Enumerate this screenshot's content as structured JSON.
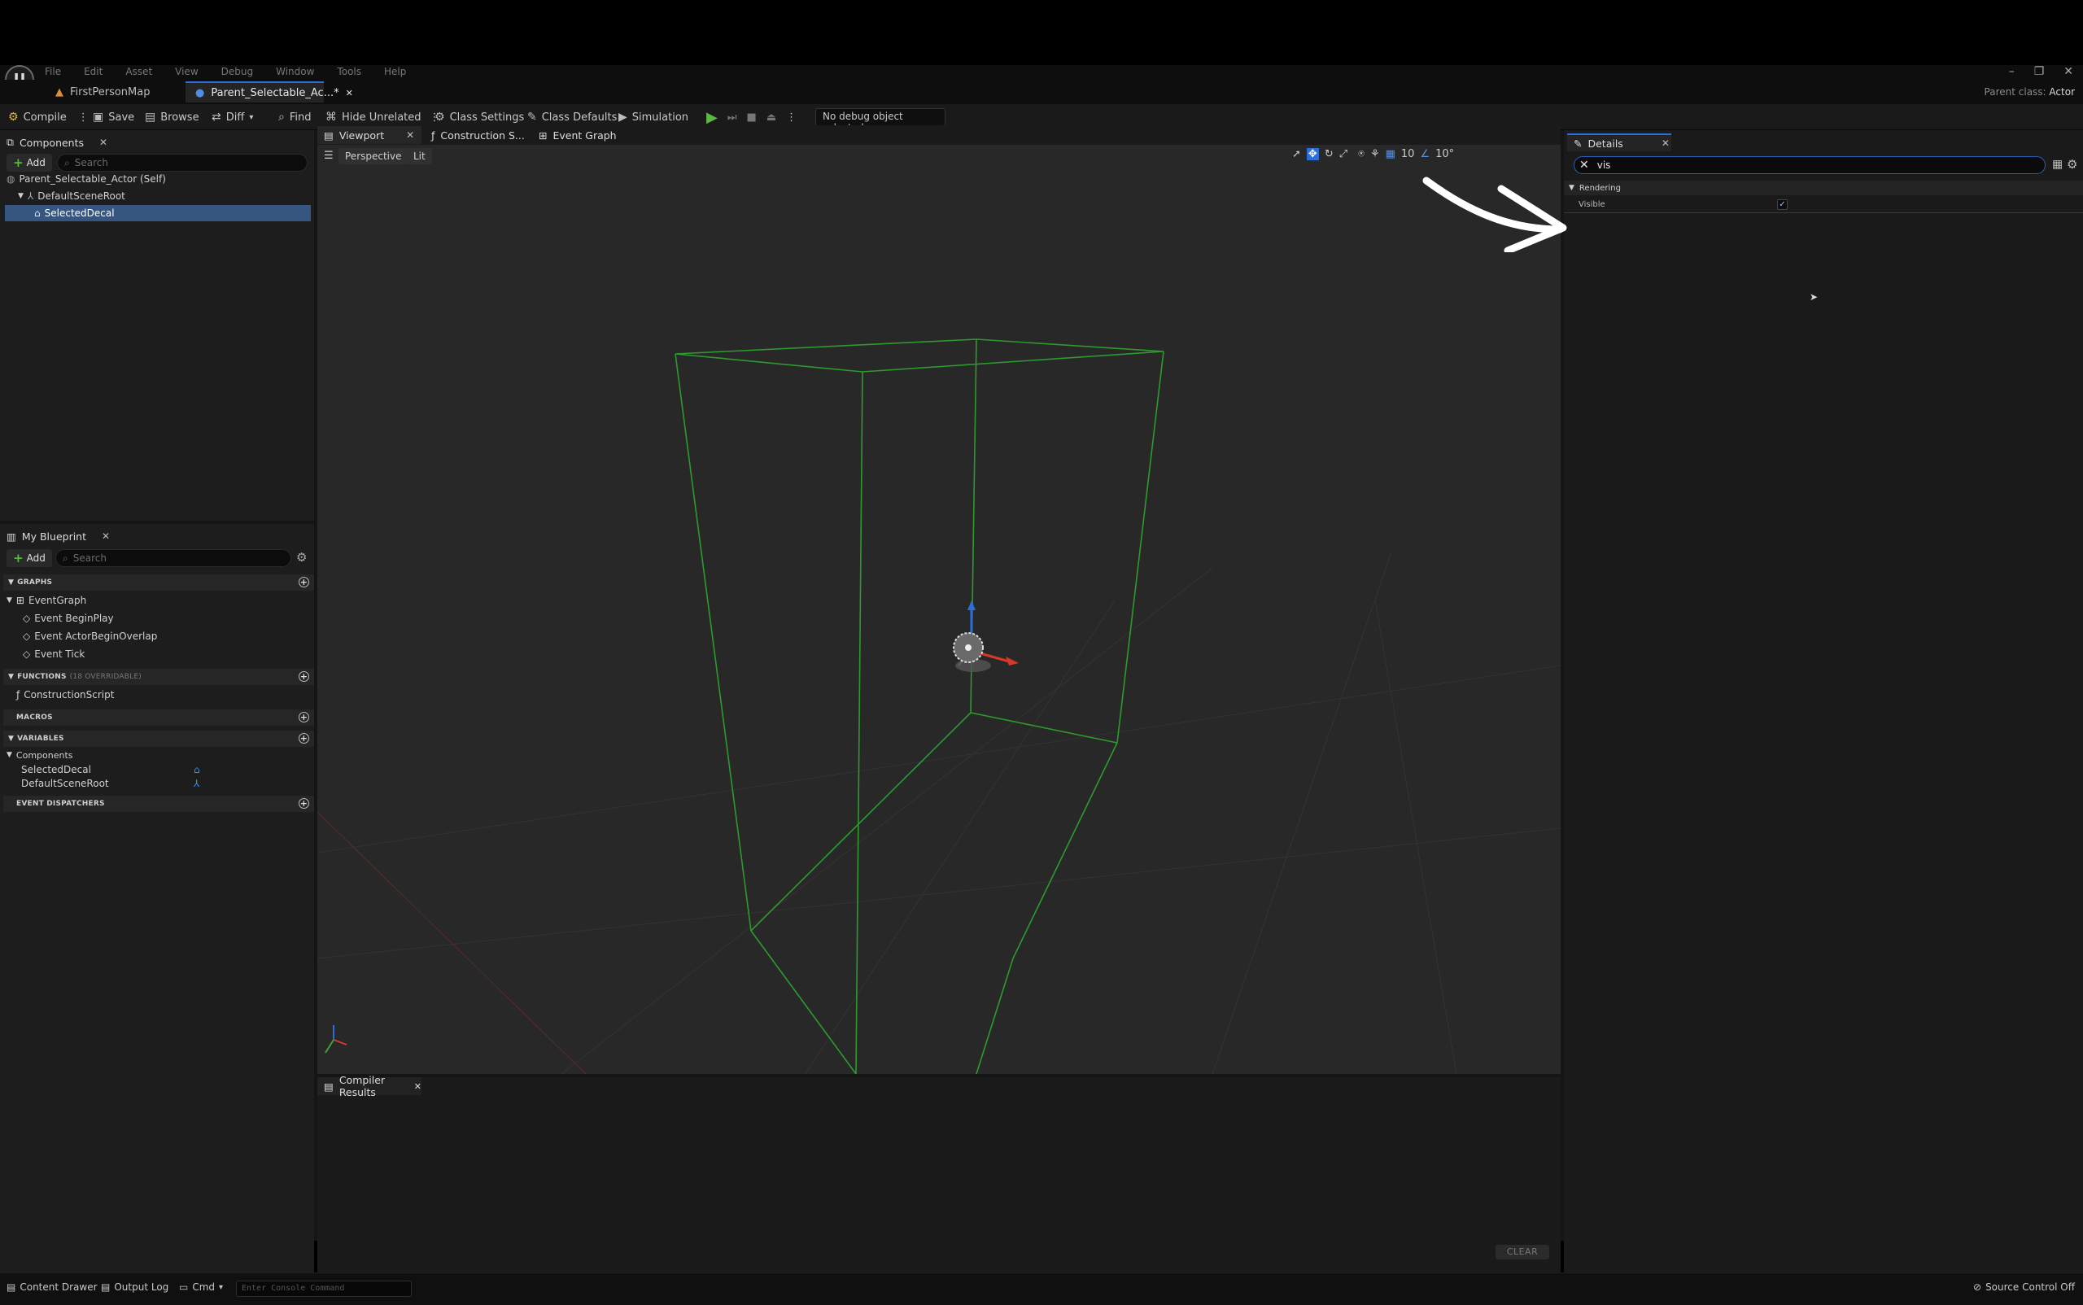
{
  "menu": {
    "items": [
      "File",
      "Edit",
      "Asset",
      "View",
      "Debug",
      "Window",
      "Tools",
      "Help"
    ]
  },
  "tabs": [
    {
      "label": "FirstPersonMap"
    },
    {
      "label": "Parent_Selectable_Ac...*"
    }
  ],
  "parent_class": {
    "label": "Parent class:",
    "value": "Actor"
  },
  "toolbar": {
    "compile": "Compile",
    "save": "Save",
    "browse": "Browse",
    "diff": "Diff",
    "find": "Find",
    "hide_unrelated": "Hide Unrelated",
    "class_settings": "Class Settings",
    "class_defaults": "Class Defaults",
    "simulation": "Simulation",
    "debug_object": "No debug object selected"
  },
  "components": {
    "tab": "Components",
    "add": "Add",
    "search_placeholder": "Search",
    "items": [
      {
        "label": "Parent_Selectable_Actor (Self)"
      },
      {
        "label": "DefaultSceneRoot"
      },
      {
        "label": "SelectedDecal"
      }
    ]
  },
  "my_blueprint": {
    "tab": "My Blueprint",
    "add": "Add",
    "search_placeholder": "Search",
    "graphs_header": "GRAPHS",
    "event_graph": "EventGraph",
    "events": [
      "Event BeginPlay",
      "Event ActorBeginOverlap",
      "Event Tick"
    ],
    "functions_header": "FUNCTIONS",
    "functions_overridable": "(18 OVERRIDABLE)",
    "construction_script": "ConstructionScript",
    "macros_header": "MACROS",
    "variables_header": "VARIABLES",
    "components_group": "Components",
    "variables": [
      "SelectedDecal",
      "DefaultSceneRoot"
    ],
    "event_dispatchers_header": "EVENT DISPATCHERS"
  },
  "editor_tabs": {
    "viewport": "Viewport",
    "construction": "Construction S...",
    "event_graph": "Event Graph"
  },
  "viewport": {
    "perspective": "Perspective",
    "lit": "Lit",
    "grid_snap": "10",
    "rot_snap": "10°"
  },
  "compiler": {
    "tab": "Compiler Results",
    "clear": "CLEAR"
  },
  "details": {
    "tab": "Details",
    "search_value": "vis",
    "section": "Rendering",
    "property_label": "Visible",
    "property_checked": true
  },
  "statusbar": {
    "content_drawer": "Content Drawer",
    "output_log": "Output Log",
    "cmd": "Cmd",
    "console_placeholder": "Enter Console Command",
    "source_control": "Source Control Off"
  },
  "colors": {
    "accent_blue": "#2b6fd6",
    "play_green": "#5db641",
    "wire_green": "#2e9a2e"
  }
}
